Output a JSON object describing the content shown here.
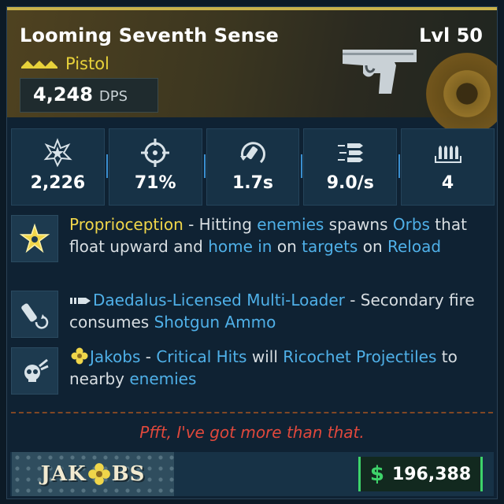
{
  "item": {
    "name": "Looming Seventh Sense",
    "level": "Lvl 50",
    "weapon_type": "Pistol",
    "dps_value": "4,248",
    "dps_unit": "DPS",
    "icon": "pistol-icon",
    "rarity_icon": "legendary-chevrons-icon",
    "rarity_color": "#e8d23a"
  },
  "stats": [
    {
      "icon": "damage-burst-icon",
      "value": "2,226"
    },
    {
      "icon": "crosshair-icon",
      "value": "71%"
    },
    {
      "icon": "reload-icon",
      "value": "1.7s"
    },
    {
      "icon": "fire-rate-icon",
      "value": "9.0/s"
    },
    {
      "icon": "magazine-icon",
      "value": "4"
    }
  ],
  "perks": [
    {
      "icon": "star-orb-icon",
      "title": "Proprioception",
      "t1": " - Hitting ",
      "k1": "enemies",
      "t2": " spawns ",
      "k2": "Orbs",
      "t3": " that float upward and ",
      "k3": "home in",
      "t4": " on ",
      "k4": "targets",
      "t5": " on ",
      "k5": "Reload"
    },
    {
      "icon": "shotgun-shell-icon",
      "title": "Daedalus-Licensed Multi-Loader",
      "t1": " - Secondary fire consumes ",
      "k1": "Shotgun Ammo"
    },
    {
      "icon": "skull-icon",
      "title": "Jakobs",
      "t1": " - ",
      "k1": "Critical Hits",
      "t2": " will ",
      "k2": "Ricochet Projectiles",
      "t3": " to nearby ",
      "k3": "enemies"
    }
  ],
  "flavor_text": "Pfft, I've got more than that.",
  "footer": {
    "manufacturer": "JAKOBS",
    "manufacturer_pre": "JAK",
    "manufacturer_post": "BS",
    "currency_symbol": "$",
    "price": "196,388",
    "price_color": "#3ed36a"
  }
}
